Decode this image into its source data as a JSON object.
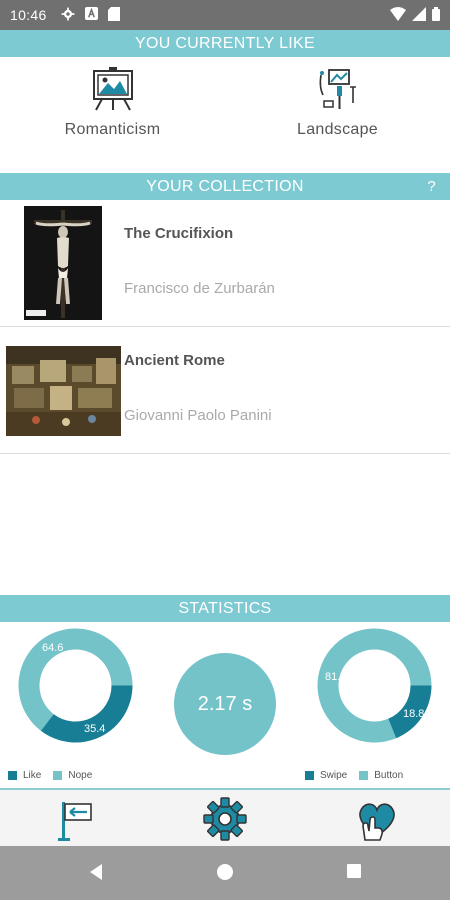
{
  "status_bar": {
    "time": "10:46"
  },
  "likes": {
    "header": "YOU CURRENTLY LIKE",
    "items": [
      {
        "label": "Romanticism",
        "icon": "easel-painting-icon"
      },
      {
        "label": "Landscape",
        "icon": "paint-tools-icon"
      }
    ]
  },
  "collection": {
    "header": "YOUR COLLECTION",
    "help": "?",
    "items": [
      {
        "title": "The Crucifixion",
        "artist": "Francisco de Zurbarán"
      },
      {
        "title": "Ancient Rome",
        "artist": "Giovanni Paolo Panini"
      }
    ]
  },
  "statistics": {
    "header": "STATISTICS",
    "average_time": "2.17 s",
    "like_chart": {
      "slices": [
        {
          "name": "Like",
          "value": 35.4,
          "label": "35.4",
          "color": "#177e95"
        },
        {
          "name": "Nope",
          "value": 64.6,
          "label": "64.6",
          "color": "#73c3c8"
        }
      ]
    },
    "method_chart": {
      "slices": [
        {
          "name": "Swipe",
          "value": 18.8,
          "label": "18.8",
          "color": "#177e95"
        },
        {
          "name": "Button",
          "value": 81.2,
          "label": "81.2",
          "color": "#73c3c8"
        }
      ]
    }
  },
  "colors": {
    "accent": "#7ecad3",
    "dark_teal": "#177e95",
    "light_teal": "#73c3c8",
    "icon_teal": "#1f8aa3"
  },
  "bottom_nav": [
    {
      "icon": "back-sign-icon"
    },
    {
      "icon": "gear-icon"
    },
    {
      "icon": "heart-hand-icon"
    }
  ]
}
